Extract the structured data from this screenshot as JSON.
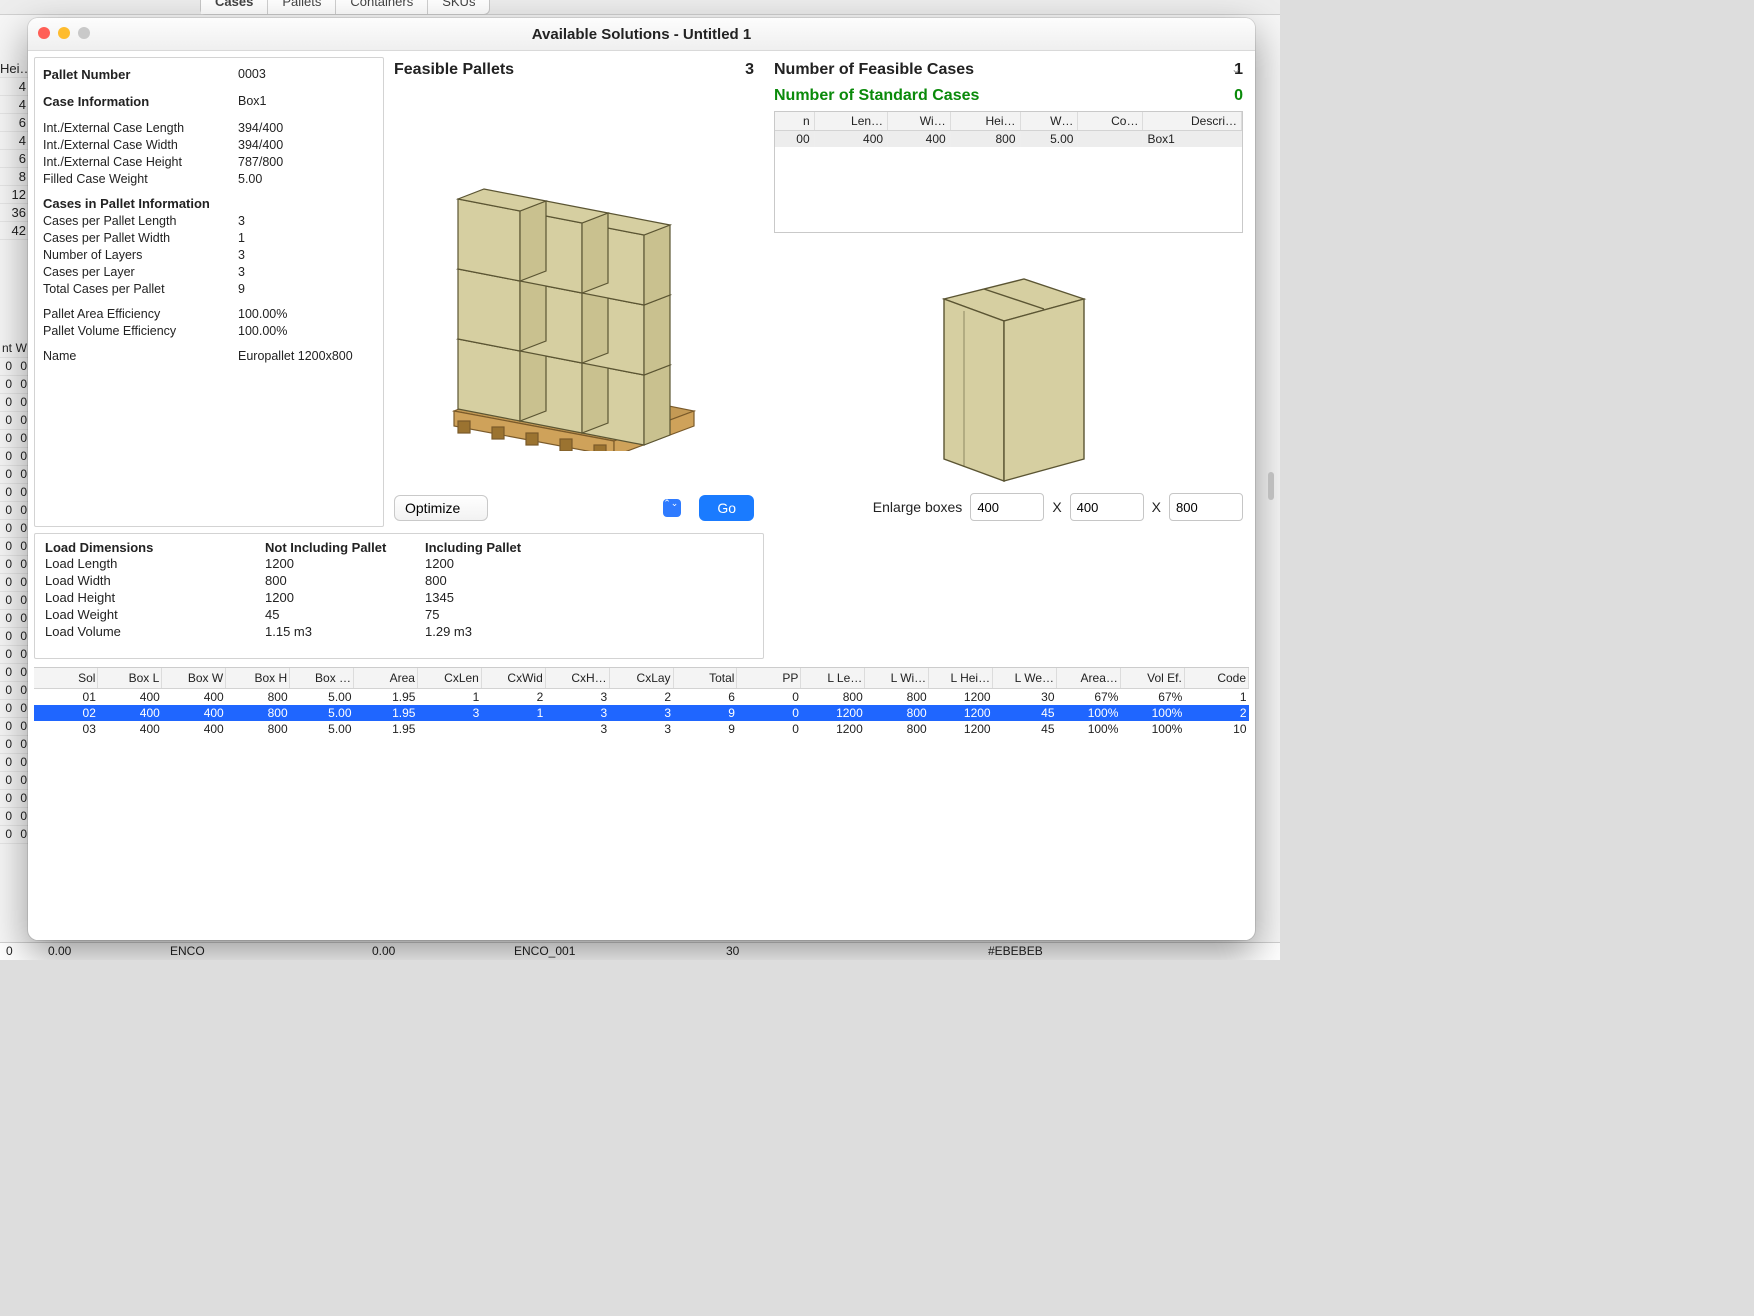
{
  "bg": {
    "top_tabs": [
      "Cases",
      "Pallets",
      "Containers",
      "SKUs"
    ],
    "left_header": "Hei…",
    "left_vals": [
      "4",
      "4",
      "6",
      "4",
      "6",
      "8",
      "12",
      "36",
      "42"
    ],
    "left_two_header": [
      "nt",
      "W"
    ],
    "left_two_rows": [
      [
        "0",
        "0"
      ],
      [
        "0",
        "0"
      ],
      [
        "0",
        "0"
      ],
      [
        "0",
        "0"
      ],
      [
        "0",
        "0"
      ],
      [
        "0",
        "0"
      ],
      [
        "0",
        "0"
      ],
      [
        "0",
        "0"
      ],
      [
        "0",
        "0"
      ],
      [
        "0",
        "0"
      ],
      [
        "0",
        "0"
      ],
      [
        "0",
        "0"
      ],
      [
        "0",
        "0"
      ],
      [
        "0",
        "0"
      ],
      [
        "0",
        "0"
      ],
      [
        "0",
        "0"
      ],
      [
        "0",
        "0"
      ],
      [
        "0",
        "0"
      ],
      [
        "0",
        "0"
      ],
      [
        "0",
        "0"
      ],
      [
        "0",
        "0"
      ],
      [
        "0",
        "0"
      ],
      [
        "0",
        "0"
      ],
      [
        "0",
        "0"
      ],
      [
        "0",
        "0"
      ],
      [
        "0",
        "0"
      ],
      [
        "0",
        "0"
      ]
    ],
    "bottom": [
      "0",
      "0.00",
      "ENCO",
      "0.00",
      "ENCO_001",
      "30",
      "#EBEBEB"
    ]
  },
  "window": {
    "title": "Available Solutions - Untitled 1"
  },
  "info": {
    "pallet_number_label": "Pallet Number",
    "pallet_number": "0003",
    "case_info_label": "Case Information",
    "case_info": "Box1",
    "ie_len_label": "Int./External Case Length",
    "ie_len": "394/400",
    "ie_wid_label": "Int./External Case Width",
    "ie_wid": "394/400",
    "ie_hei_label": "Int./External Case Height",
    "ie_hei": "787/800",
    "fill_wt_label": "Filled Case Weight",
    "fill_wt": "5.00",
    "cip_label": "Cases in Pallet Information",
    "cpl_label": "Cases per Pallet Length",
    "cpl": "3",
    "cpw_label": "Cases per Pallet Width",
    "cpw": "1",
    "layers_label": "Number of Layers",
    "layers": "3",
    "cplay_label": "Cases per Layer",
    "cplay": "3",
    "tcp_label": "Total Cases per Pallet",
    "tcp": "9",
    "pae_label": "Pallet Area Efficiency",
    "pae": "100.00%",
    "pve_label": "Pallet Volume Efficiency",
    "pve": "100.00%",
    "name_label": "Name",
    "name": "Europallet 1200x800"
  },
  "load": {
    "title": "Load Dimensions",
    "h_notinc": "Not Including Pallet",
    "h_inc": "Including Pallet",
    "rows": [
      {
        "l": "Load Length",
        "a": "1200",
        "b": "1200"
      },
      {
        "l": "Load Width",
        "a": "800",
        "b": "800"
      },
      {
        "l": "Load Height",
        "a": "1200",
        "b": "1345"
      },
      {
        "l": "Load Weight",
        "a": "45",
        "b": "75"
      },
      {
        "l": "Load Volume",
        "a": "1.15 m3",
        "b": "1.29 m3"
      }
    ]
  },
  "center": {
    "heading": "Feasible Pallets",
    "count": "3",
    "select_value": "Optimize",
    "go": "Go"
  },
  "right": {
    "h1_label": "Number of Feasible Cases",
    "h1_val": "1",
    "h2_label": "Number of Standard Cases",
    "h2_val": "0",
    "grid_headers": [
      "n",
      "Len…",
      "Wi…",
      "Hei…",
      "W…",
      "Co…",
      "Descri…"
    ],
    "grid_row": [
      "00",
      "400",
      "400",
      "800",
      "5.00",
      "",
      "Box1"
    ],
    "enlarge_label": "Enlarge boxes",
    "enlarge": {
      "x": "400",
      "y": "400",
      "z": "800"
    },
    "x_sep": "X"
  },
  "sol": {
    "headers": [
      "Sol",
      "Box L",
      "Box W",
      "Box H",
      "Box …",
      "Area",
      "CxLen",
      "CxWid",
      "CxH…",
      "CxLay",
      "Total",
      "PP",
      "L Le…",
      "L Wi…",
      "L Hei…",
      "L We…",
      "Area…",
      "Vol Ef.",
      "Code"
    ],
    "rows": [
      [
        "01",
        "400",
        "400",
        "800",
        "5.00",
        "1.95",
        "1",
        "2",
        "3",
        "2",
        "6",
        "0",
        "800",
        "800",
        "1200",
        "30",
        "67%",
        "67%",
        "1"
      ],
      [
        "02",
        "400",
        "400",
        "800",
        "5.00",
        "1.95",
        "3",
        "1",
        "3",
        "3",
        "9",
        "0",
        "1200",
        "800",
        "1200",
        "45",
        "100%",
        "100%",
        "2"
      ],
      [
        "03",
        "400",
        "400",
        "800",
        "5.00",
        "1.95",
        "",
        "",
        "3",
        "3",
        "9",
        "0",
        "1200",
        "800",
        "1200",
        "45",
        "100%",
        "100%",
        "10"
      ]
    ],
    "selected": 1
  }
}
